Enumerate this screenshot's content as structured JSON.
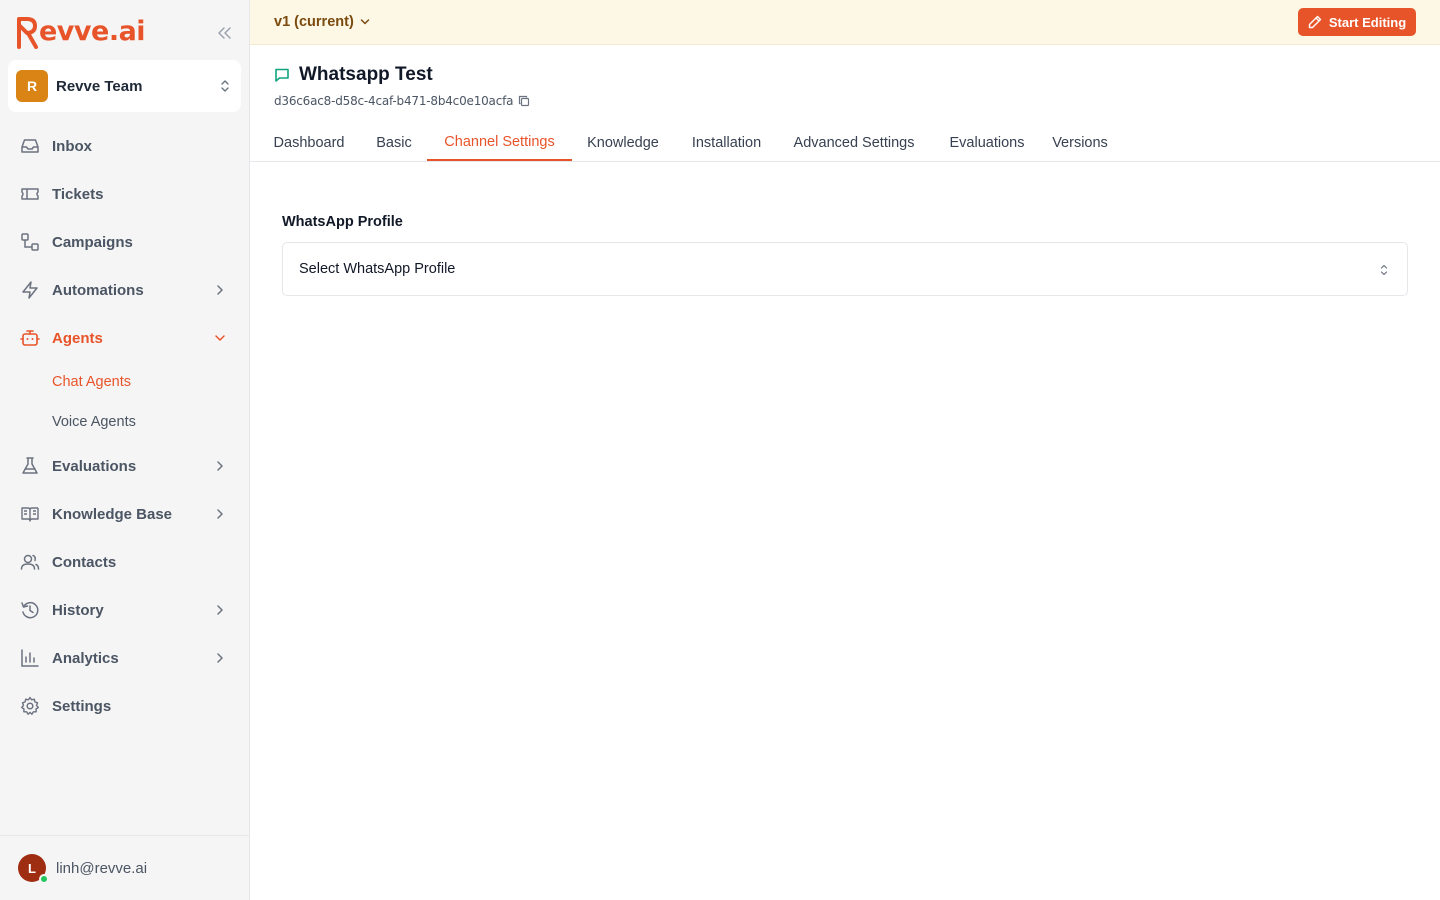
{
  "brand": {
    "name": "evve.ai",
    "accent": "#e8542a"
  },
  "team": {
    "initial": "R",
    "name": "Revve Team"
  },
  "nav": {
    "inbox": "Inbox",
    "tickets": "Tickets",
    "campaigns": "Campaigns",
    "automations": "Automations",
    "agents": "Agents",
    "chat_agents": "Chat Agents",
    "voice_agents": "Voice Agents",
    "evaluations": "Evaluations",
    "knowledge_base": "Knowledge Base",
    "contacts": "Contacts",
    "history": "History",
    "analytics": "Analytics",
    "settings": "Settings"
  },
  "user": {
    "initial": "L",
    "email": "linh@revve.ai"
  },
  "topbar": {
    "version": "v1 (current)",
    "start_editing": "Start Editing"
  },
  "agent": {
    "title": "Whatsapp Test",
    "id": "d36c6ac8-d58c-4caf-b471-8b4c0e10acfa"
  },
  "tabs": {
    "dashboard": "Dashboard",
    "basic": "Basic",
    "channel_settings": "Channel Settings",
    "knowledge": "Knowledge",
    "installation": "Installation",
    "advanced_settings": "Advanced Settings",
    "evaluations": "Evaluations",
    "versions": "Versions"
  },
  "form": {
    "whatsapp_label": "WhatsApp Profile",
    "whatsapp_placeholder": "Select WhatsApp Profile"
  }
}
